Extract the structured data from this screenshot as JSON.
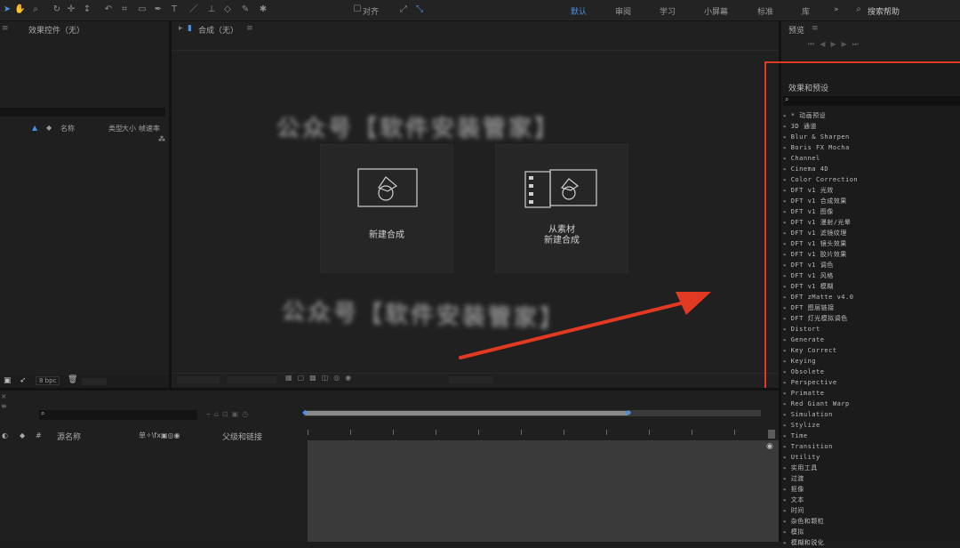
{
  "toolbar": {
    "snap_label": "对齐",
    "workspaces": [
      "默认",
      "审阅",
      "学习",
      "小屏幕",
      "标准",
      "库"
    ],
    "more": "»",
    "search_placeholder": "搜索帮助",
    "active_workspace_index": 0
  },
  "project_panel": {
    "title": "效果控件（无）",
    "columns": {
      "name": "名称",
      "type": "类型",
      "size": "大小",
      "frame_rate": "帧速率"
    },
    "bpc": "8 bpc"
  },
  "composition_panel": {
    "title": "合成（无）",
    "new_comp_label": "新建合成",
    "from_footage_line1": "从素材",
    "from_footage_line2": "新建合成",
    "blurred_lines": [
      "公众号【软件安装管家】",
      "公众号【软件安装管家】"
    ]
  },
  "preview_panel": {
    "title": "预览"
  },
  "effects_panel": {
    "title": "效果和预设",
    "search_placeholder": "",
    "items": [
      "* 动画预设",
      "3D 通道",
      "Blur & Sharpen",
      "Boris FX Mocha",
      "Channel",
      "Cinema 4D",
      "Color Correction",
      "DFT v1 光效",
      "DFT v1 合成效果",
      "DFT v1 图像",
      "DFT v1 漫射/光晕",
      "DFT v1 滤镜纹理",
      "DFT v1 镜头效果",
      "DFT v1 胶片效果",
      "DFT v1 调色",
      "DFT v1 风格",
      "DFT v1 模糊",
      "DFT zMatte v4.0",
      "DFT 图层链接",
      "DFT 灯光模拟调色",
      "Distort",
      "Generate",
      "Key Correct",
      "Keying",
      "Obsolete",
      "Perspective",
      "Primatte",
      "Red Giant Warp",
      "Simulation",
      "Stylize",
      "Time",
      "Transition",
      "Utility",
      "实用工具",
      "过渡",
      "抠像",
      "文本",
      "时间",
      "杂色和颗粒",
      "模拟",
      "模糊和锐化"
    ]
  },
  "timeline_panel": {
    "col_source": "源名称",
    "col_switches": "单✧\\fx▣◎◉",
    "col_parent": "父级和链接"
  },
  "colors": {
    "accent": "#4a8fe0",
    "highlight_box": "#e23a22",
    "arrow": "#e23a22"
  }
}
